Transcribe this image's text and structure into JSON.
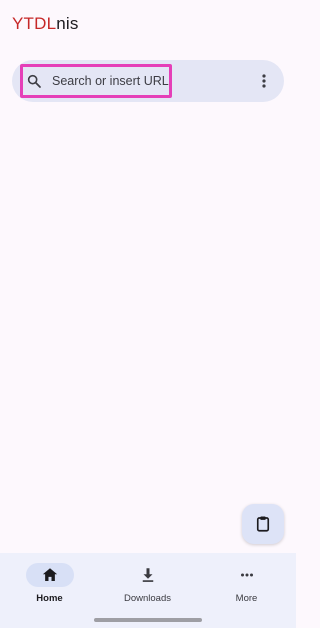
{
  "app": {
    "title_part1": "YTDL",
    "title_part2": "nis",
    "brand_color": "#c62828"
  },
  "search": {
    "placeholder": "Search or insert URL",
    "icon": "search-icon",
    "menu_icon": "more-vert-icon",
    "highlight_color": "#e53fb8"
  },
  "fab": {
    "icon": "clipboard-icon"
  },
  "bottom_nav": {
    "items": [
      {
        "label": "Home",
        "icon": "home-icon",
        "active": true
      },
      {
        "label": "Downloads",
        "icon": "download-icon",
        "active": false
      },
      {
        "label": "More",
        "icon": "more-horiz-icon",
        "active": false
      }
    ]
  }
}
